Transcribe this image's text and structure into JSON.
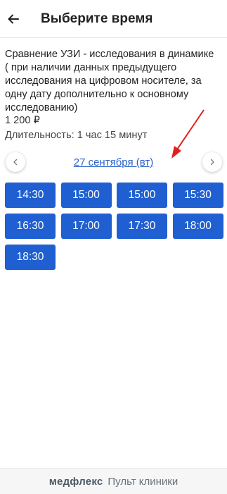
{
  "header": {
    "title": "Выберите время",
    "back_icon": "arrow-left-icon"
  },
  "service": {
    "name": "Сравнение УЗИ - исследования в динамике ( при наличии данных предыдущего исследования на цифровом носителе, за одну дату дополнительно к основному исследованию)",
    "price": "1 200 ₽",
    "duration": "Длительность: 1 час 15 минут"
  },
  "date_nav": {
    "current_date": "27 сентября (вт)",
    "prev_icon": "chevron-left-icon",
    "next_icon": "chevron-right-icon"
  },
  "slots": [
    "14:30",
    "15:00",
    "15:00",
    "15:30",
    "16:30",
    "17:00",
    "17:30",
    "18:00",
    "18:30"
  ],
  "annotation": {
    "arrow_color": "#e02020"
  },
  "footer": {
    "brand": "медфлекс",
    "subtitle": "Пульт клиники"
  },
  "colors": {
    "accent": "#1f5fd1",
    "link": "#2a63c8"
  }
}
